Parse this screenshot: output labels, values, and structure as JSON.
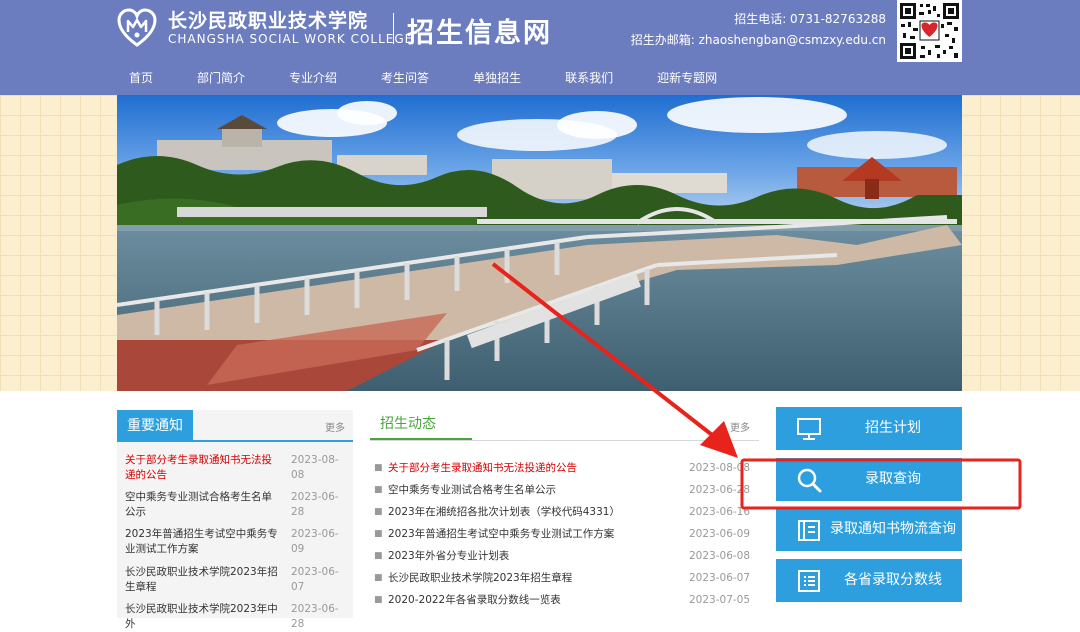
{
  "header": {
    "school_name_cn": "长沙民政职业技术学院",
    "school_name_en": "CHANGSHA SOCIAL WORK COLLEGE",
    "site_name": "招生信息网",
    "phone": "招生电话: 0731-82763288",
    "email": "招生办邮箱: zhaoshengban@csmzxy.edu.cn"
  },
  "nav": {
    "items": [
      "首页",
      "部门简介",
      "专业介绍",
      "考生问答",
      "单独招生",
      "联系我们",
      "迎新专题网"
    ]
  },
  "notices": {
    "title": "重要通知",
    "more": "更多",
    "items": [
      {
        "text": "关于部分考生录取通知书无法投递的公告",
        "date": "2023-08-08"
      },
      {
        "text": "空中乘务专业测试合格考生名单公示",
        "date": "2023-06-28"
      },
      {
        "text": "2023年普通招生考试空中乘务专业测试工作方案",
        "date": "2023-06-09"
      },
      {
        "text": "长沙民政职业技术学院2023年招生章程",
        "date": "2023-06-07"
      },
      {
        "text": "长沙民政职业技术学院2023年中外",
        "date": "2023-06-28"
      }
    ]
  },
  "news": {
    "title": "招生动态",
    "more": "更多",
    "items": [
      {
        "text": "关于部分考生录取通知书无法投递的公告",
        "date": "2023-08-08"
      },
      {
        "text": "空中乘务专业测试合格考生名单公示",
        "date": "2023-06-28"
      },
      {
        "text": "2023年在湘统招各批次计划表（学校代码4331）",
        "date": "2023-06-16"
      },
      {
        "text": "2023年普通招生考试空中乘务专业测试工作方案",
        "date": "2023-06-09"
      },
      {
        "text": "2023年外省分专业计划表",
        "date": "2023-06-08"
      },
      {
        "text": "长沙民政职业技术学院2023年招生章程",
        "date": "2023-06-07"
      },
      {
        "text": "2020-2022年各省录取分数线一览表",
        "date": "2023-07-05"
      }
    ]
  },
  "side_buttons": [
    {
      "label": "招生计划",
      "icon": "monitor-icon"
    },
    {
      "label": "录取查询",
      "icon": "search-icon"
    },
    {
      "label": "录取通知书物流查询",
      "icon": "document-icon"
    },
    {
      "label": "各省录取分数线",
      "icon": "list-icon"
    }
  ],
  "colors": {
    "header_bg": "#6c7dbf",
    "accent_blue": "#2e9fde",
    "accent_green": "#4aa63c",
    "alert_red": "#d60000",
    "annotation_red": "#e8231c"
  }
}
